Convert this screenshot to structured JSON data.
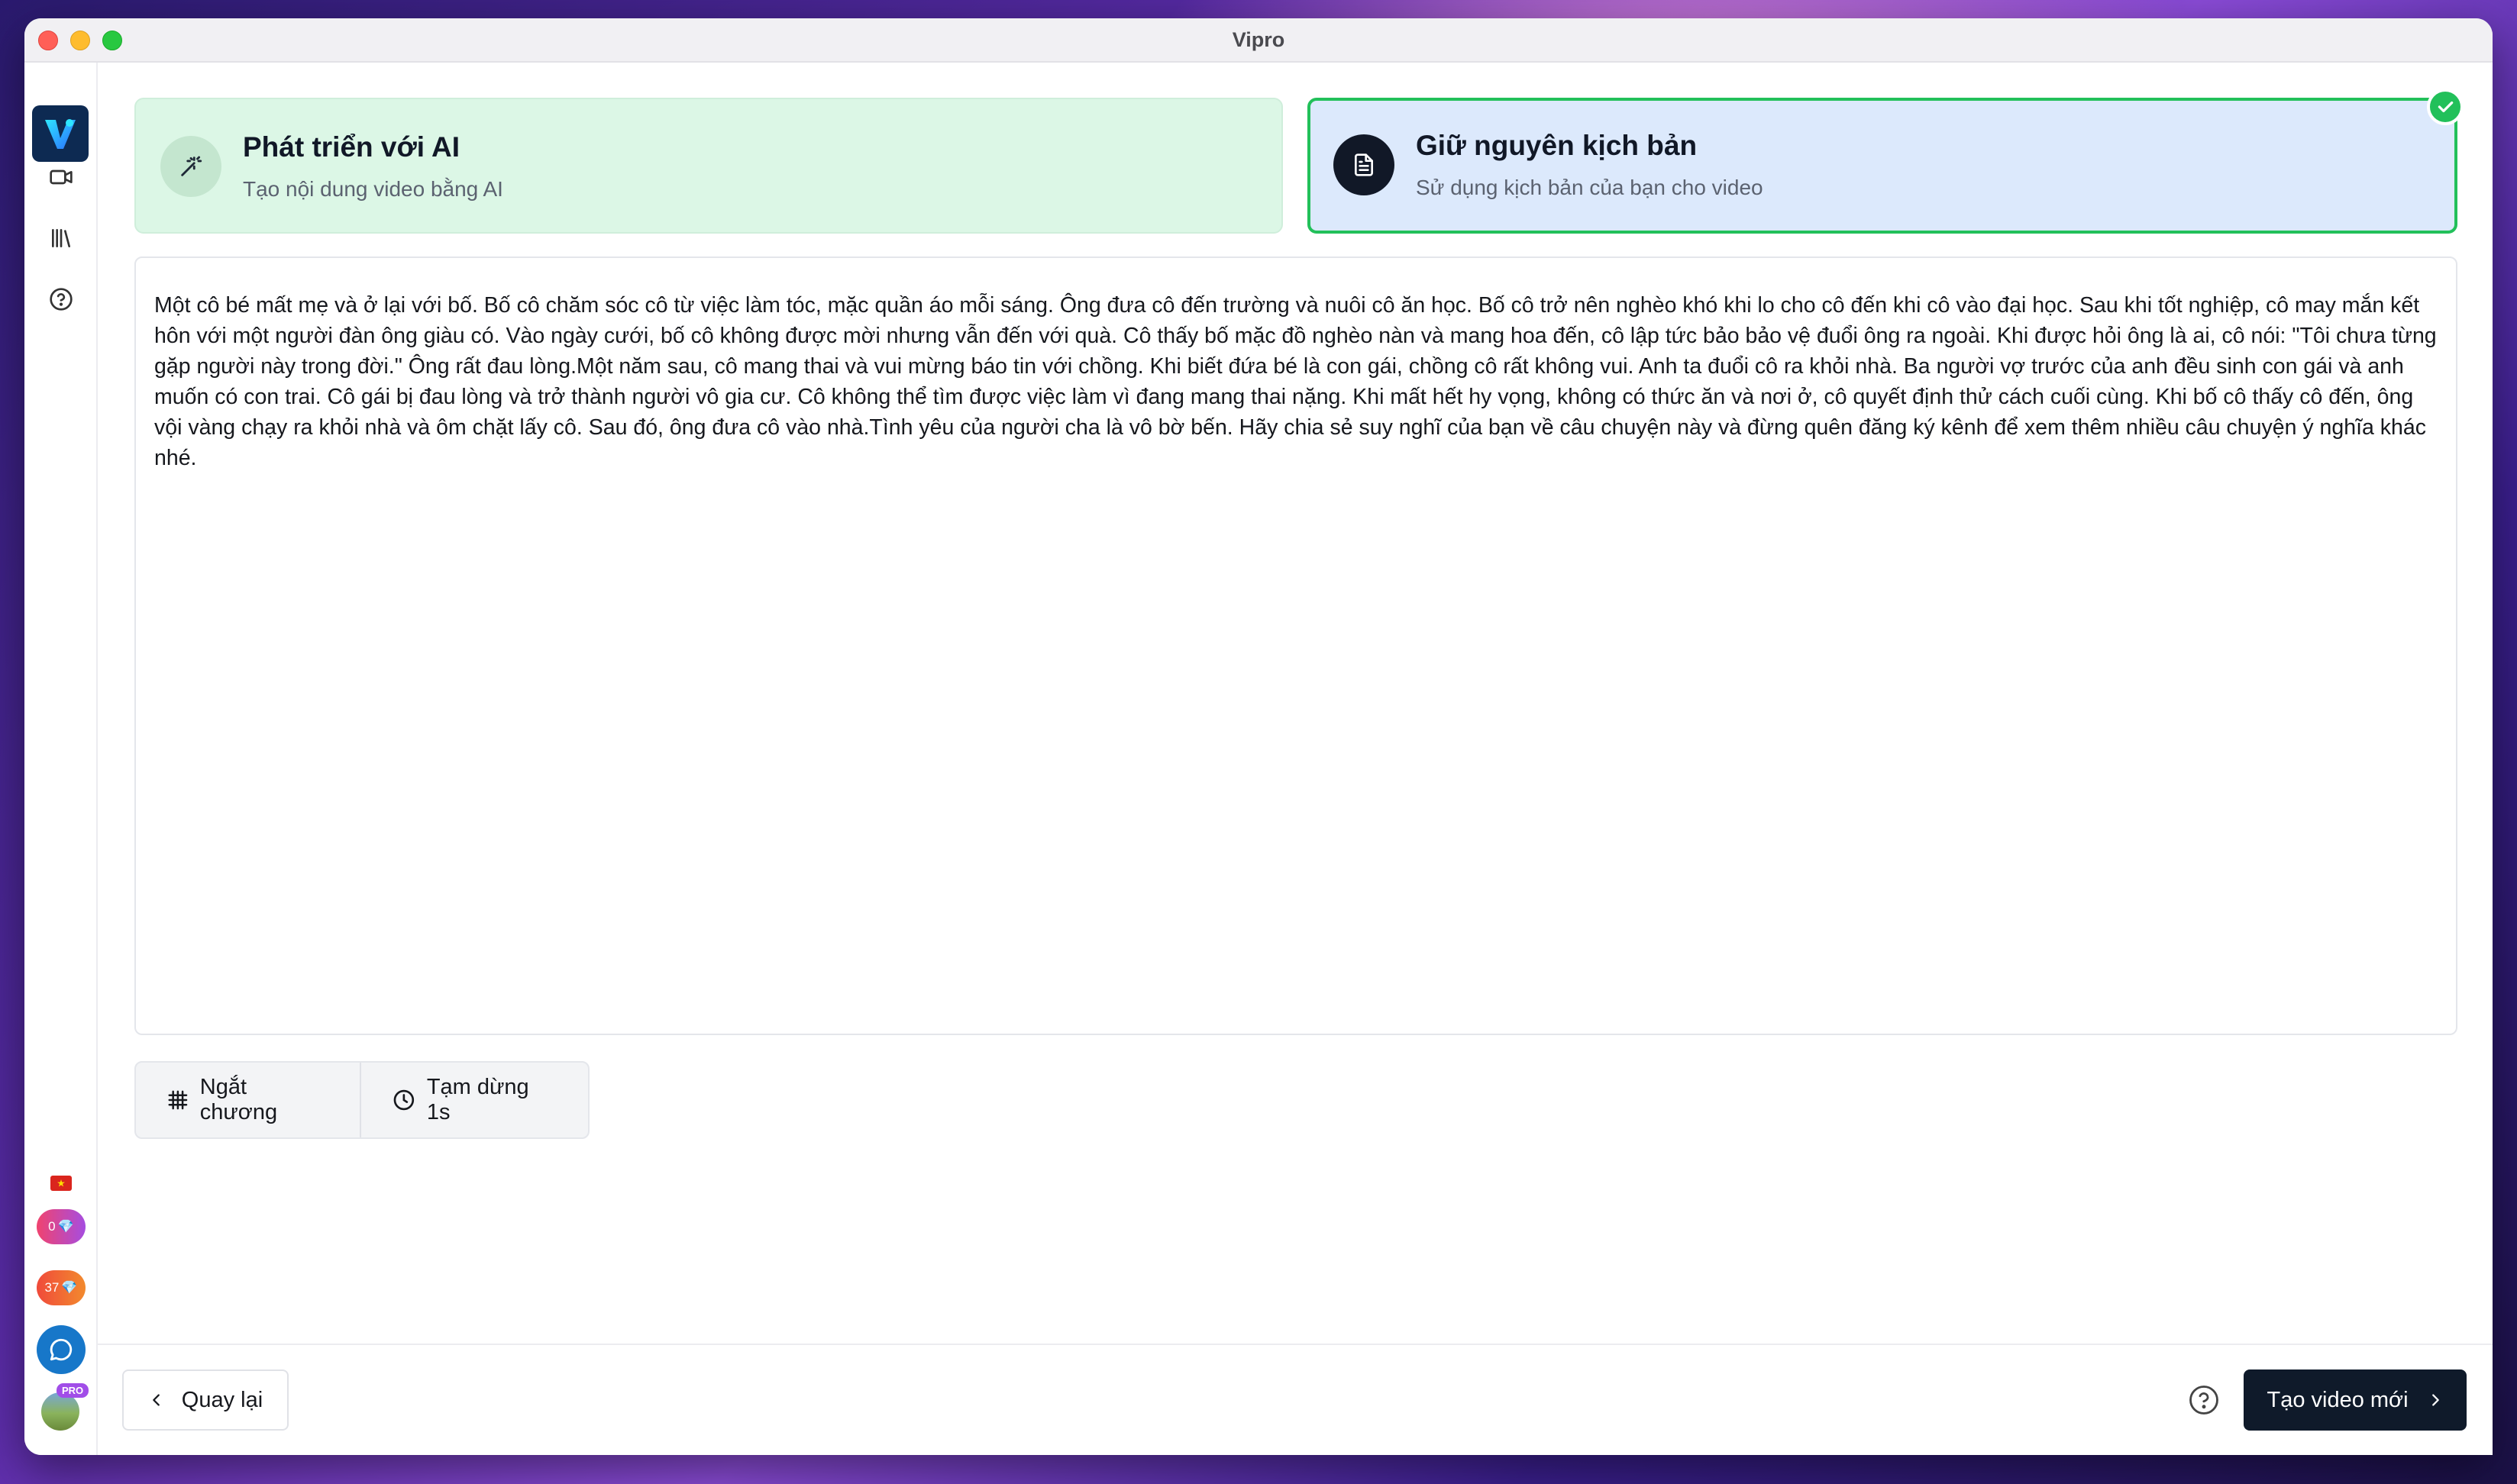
{
  "window": {
    "title": "Vipro"
  },
  "sidebar": {
    "items": [
      {
        "name": "video-icon"
      },
      {
        "name": "library-icon"
      },
      {
        "name": "help-circle-icon"
      }
    ],
    "gems_count": "0",
    "coins_count": "37",
    "pro_label": "PRO"
  },
  "cards": {
    "ai": {
      "title": "Phát triển với AI",
      "subtitle": "Tạo nội dung video bằng AI",
      "icon": "magic-wand-icon"
    },
    "script": {
      "title": "Giữ nguyên kịch bản",
      "subtitle": "Sử dụng kịch bản của bạn cho video",
      "icon": "document-icon",
      "selected": true
    }
  },
  "editor": {
    "text": "Một cô bé mất mẹ và ở lại với bố. Bố cô chăm sóc cô từ việc làm tóc, mặc quần áo mỗi sáng. Ông đưa cô đến trường và nuôi cô ăn học. Bố cô trở nên nghèo khó khi lo cho cô đến khi cô vào đại học. Sau khi tốt nghiệp, cô may mắn kết hôn với một người đàn ông giàu có. Vào ngày cưới, bố cô không được mời nhưng vẫn đến với quà. Cô thấy bố mặc đồ nghèo nàn và mang hoa đến, cô lập tức bảo bảo vệ đuổi ông ra ngoài. Khi được hỏi ông là ai, cô nói: \"Tôi chưa từng gặp người này trong đời.\" Ông rất đau lòng.Một năm sau, cô mang thai và vui mừng báo tin với chồng. Khi biết đứa bé là con gái, chồng cô rất không vui. Anh ta đuổi cô ra khỏi nhà. Ba người vợ trước của anh đều sinh con gái và anh muốn có con trai. Cô gái bị đau lòng và trở thành người vô gia cư. Cô không thể tìm được việc làm vì đang mang thai nặng. Khi mất hết hy vọng, không có thức ăn và nơi ở, cô quyết định thử cách cuối cùng. Khi bố cô thấy cô đến, ông vội vàng chạy ra khỏi nhà và ôm chặt lấy cô. Sau đó, ông đưa cô vào nhà.Tình yêu của người cha là vô bờ bến. Hãy chia sẻ suy nghĩ của bạn về câu chuyện này và đừng quên đăng ký kênh để xem thêm nhiều câu chuyện ý nghĩa khác nhé."
  },
  "toolbar": {
    "chapter_break_label": "Ngắt chương",
    "pause_label": "Tạm dừng 1s"
  },
  "footer": {
    "back_label": "Quay lại",
    "create_label": "Tạo video mới"
  },
  "colors": {
    "accent_green": "#22c05a",
    "primary_dark": "#0f1a2a",
    "ai_card_bg": "#dcf7e6",
    "script_card_bg": "#dce9fc"
  }
}
